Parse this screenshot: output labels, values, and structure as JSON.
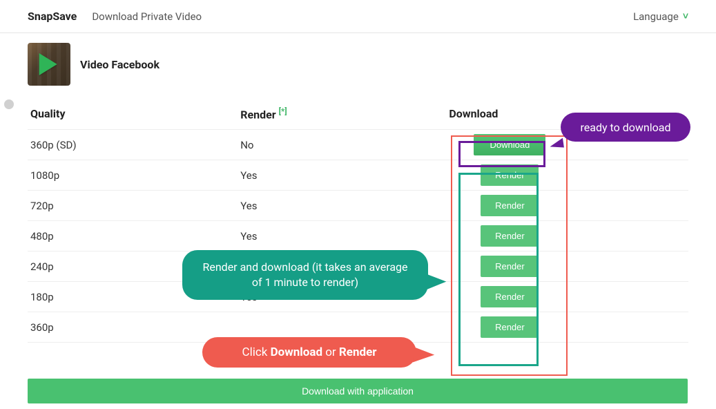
{
  "topbar": {
    "brand": "SnapSave",
    "nav_link": "Download Private Video",
    "language_label": "Language"
  },
  "video": {
    "title": "Video Facebook"
  },
  "table": {
    "headers": {
      "quality": "Quality",
      "render": "Render",
      "render_asterisk": "[*]",
      "download": "Download"
    },
    "rows": [
      {
        "quality": "360p (SD)",
        "render": "No",
        "action": "Download"
      },
      {
        "quality": "1080p",
        "render": "Yes",
        "action": "Render"
      },
      {
        "quality": "720p",
        "render": "Yes",
        "action": "Render"
      },
      {
        "quality": "480p",
        "render": "Yes",
        "action": "Render"
      },
      {
        "quality": "240p",
        "render": "",
        "action": "Render"
      },
      {
        "quality": "180p",
        "render": "Yes",
        "action": "Render"
      },
      {
        "quality": "360p",
        "render": "",
        "action": "Render"
      }
    ]
  },
  "footer": {
    "download_app_label": "Download with application"
  },
  "annotations": {
    "ready_label": "ready to download",
    "render_label": "Render and download (it takes an average of 1 minute to render)",
    "click_prefix": "Click ",
    "click_b1": "Download",
    "click_mid": " or ",
    "click_b2": "Render"
  },
  "colors": {
    "green": "#49c170",
    "purple": "#6a1b9a",
    "teal": "#159e86",
    "red": "#ef5b4f"
  }
}
